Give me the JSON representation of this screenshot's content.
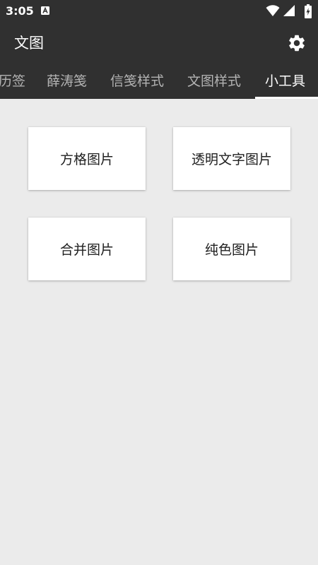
{
  "status_bar": {
    "time": "3:05",
    "icons": [
      "app-notification-icon",
      "wifi-icon",
      "signal-icon",
      "battery-charging-icon"
    ]
  },
  "app_bar": {
    "title": "文图",
    "settings_icon": "gear-icon"
  },
  "tabs": [
    {
      "label": "历签",
      "active": false
    },
    {
      "label": "薛涛笺",
      "active": false
    },
    {
      "label": "信笺样式",
      "active": false
    },
    {
      "label": "文图样式",
      "active": false
    },
    {
      "label": "小工具",
      "active": true
    }
  ],
  "tools": [
    {
      "label": "方格图片"
    },
    {
      "label": "透明文字图片"
    },
    {
      "label": "合并图片"
    },
    {
      "label": "纯色图片"
    }
  ],
  "colors": {
    "toolbar": "#303030",
    "background": "#ebebeb",
    "card": "#ffffff",
    "tab_inactive": "#b3b3b3",
    "tab_active": "#ffffff"
  }
}
